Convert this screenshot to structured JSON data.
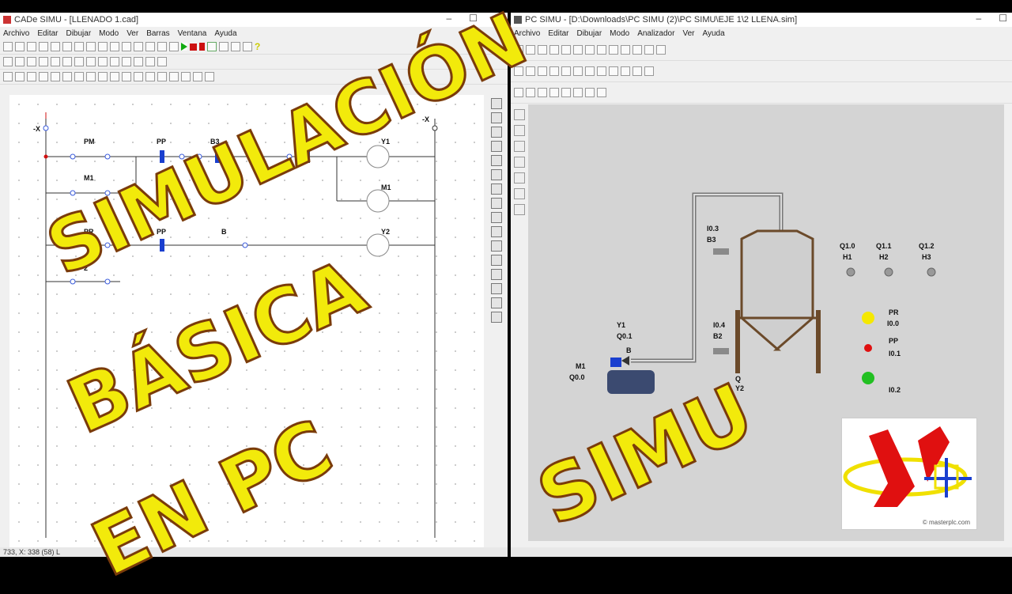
{
  "left_window": {
    "title": "CADe SIMU - [LLENADO 1.cad]",
    "menu": [
      "Archivo",
      "Editar",
      "Dibujar",
      "Modo",
      "Ver",
      "Barras",
      "Ventana",
      "Ayuda"
    ],
    "status": "733, X: 338 (58) L",
    "diagram": {
      "rail_left": "-X",
      "rail_right": "-X",
      "contacts": [
        "PM",
        "PP",
        "B3",
        "Y2",
        "M1",
        "PR",
        "PP",
        "B",
        "2"
      ],
      "coils": [
        "Y1",
        "M1",
        "Y2"
      ]
    }
  },
  "right_window": {
    "title": "PC SIMU - [D:\\Downloads\\PC SIMU (2)\\PC SIMU\\EJE 1\\2 LLENA.sim]",
    "menu": [
      "Archivo",
      "Editar",
      "Dibujar",
      "Modo",
      "Analizador",
      "Ver",
      "Ayuda"
    ],
    "status": "",
    "simulation": {
      "labels": {
        "i03": "I0.3",
        "b3": "B3",
        "i04": "I0.4",
        "b2": "B2",
        "y1": "Y1",
        "q01": "Q0.1",
        "m1": "M1",
        "q00": "Q0.0",
        "q10": "Q1.0",
        "h1": "H1",
        "q11": "Q1.1",
        "h2": "H2",
        "q12": "Q1.2",
        "h3": "H3",
        "pr": "PR",
        "i00": "I0.0",
        "pr2": "PP",
        "i01": "I0.1",
        "i02": "I0.2",
        "y2": "Y2",
        "q0": "Q",
        "valve_b": "B"
      },
      "indicator_colors": {
        "pr": "#f5e800",
        "pp": "#e01010",
        "third": "#22c022"
      }
    },
    "logo_caption": "© masterplc.com"
  },
  "overlay": {
    "line1": "SIMULACIÓN",
    "line2": "BÁSICA",
    "line3": "EN PC",
    "line4": "SIMU",
    "fill_color": "#f2ea0b",
    "outline_color": "#7a3b0a"
  },
  "colors": {
    "accent_blue": "#1a3fcf",
    "wire_blue": "#3a5bdc",
    "rail_red": "#d01010"
  }
}
